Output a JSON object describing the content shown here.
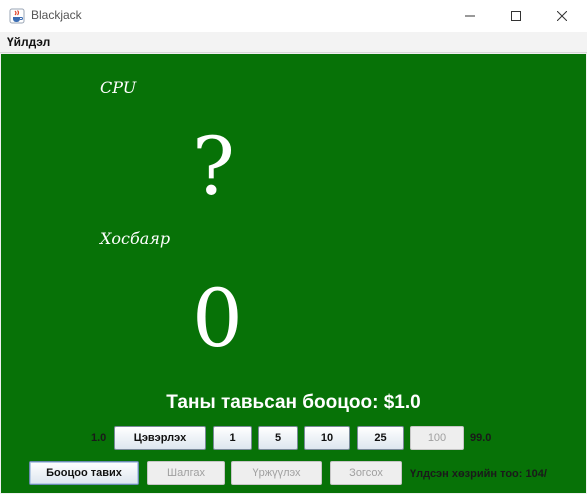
{
  "window": {
    "title": "Blackjack",
    "icon": "java-coffee-icon",
    "controls": [
      "minimize-icon",
      "maximize-icon",
      "close-icon"
    ]
  },
  "menu": {
    "items": [
      "Үйлдэл"
    ]
  },
  "table": {
    "background_color": "#077207",
    "cpu_label": "CPU",
    "cpu_value": "?",
    "player_label": "Хосбаяр",
    "player_value": "0",
    "bet_text": "Таны тавьсан бооцоо: $1.0"
  },
  "bet_controls": {
    "min_label": "1.0",
    "max_label": "99.0",
    "buttons": [
      {
        "label": "Цэвэрлэх",
        "enabled": true
      },
      {
        "label": "1",
        "enabled": true
      },
      {
        "label": "5",
        "enabled": true
      },
      {
        "label": "10",
        "enabled": true
      },
      {
        "label": "25",
        "enabled": true
      },
      {
        "label": "100",
        "enabled": false
      }
    ]
  },
  "actions": {
    "buttons": [
      {
        "label": "Бооцоо тавих",
        "enabled": true
      },
      {
        "label": "Шалгах",
        "enabled": false
      },
      {
        "label": "Үржүүлэх",
        "enabled": false
      },
      {
        "label": "Зогсох",
        "enabled": false
      }
    ],
    "status_text": "Үлдсэн хөзрийн тоо: 104/"
  }
}
